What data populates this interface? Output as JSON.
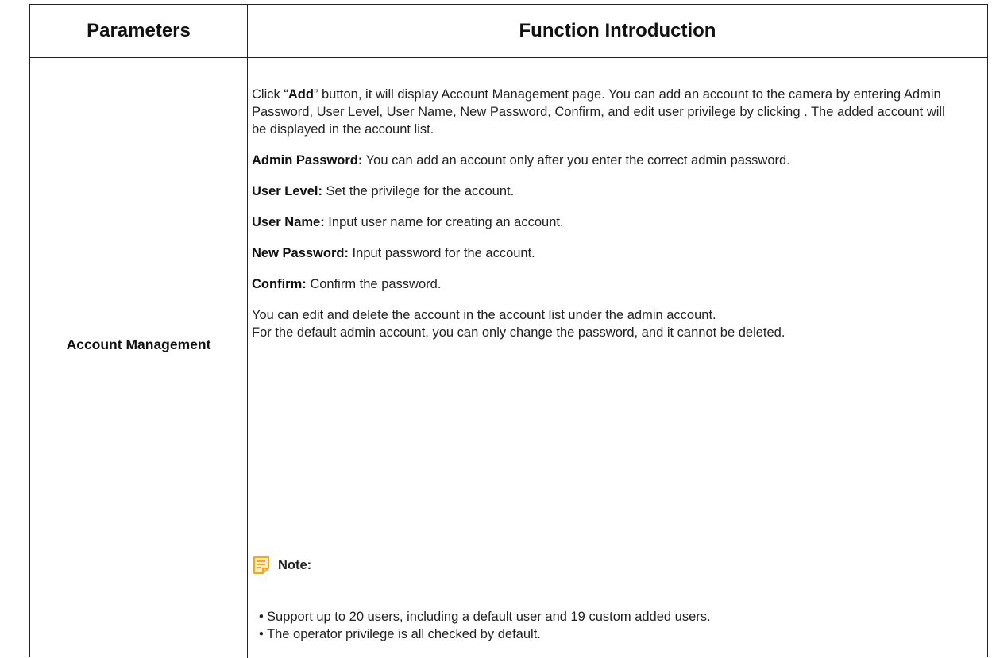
{
  "header": {
    "parameters": "Parameters",
    "function_introduction": "Function Introduction"
  },
  "row": {
    "parameter": "Account Management",
    "intro": {
      "p1_a": "Click “",
      "p1_add": "Add",
      "p1_b": "” button, it will display Account Management page. You can add an account to the camera by entering Admin Password, User Level, User Name, New Password, Confirm, and edit user privilege by clicking . The added account will be displayed in the account list.",
      "items": [
        {
          "term": "Admin Password:",
          "desc": " You can add an account only after you enter the correct admin password."
        },
        {
          "term": "User Level:",
          "desc": " Set the privilege for the account."
        },
        {
          "term": "User Name:",
          "desc": " Input user name for creating an account."
        },
        {
          "term": "New Password:",
          "desc": " Input password for the account."
        },
        {
          "term": "Confirm:",
          "desc": " Confirm the password."
        }
      ],
      "p_edit_1": "You can edit and delete the account in the account list under the admin account.",
      "p_edit_2": "For the default admin account, you can only change the password, and it cannot be deleted."
    },
    "note": {
      "icon": "note-icon",
      "label": "Note:",
      "bullet": "•",
      "items": [
        "Support up to 20 users, including a default user and 19 custom added users.",
        "The operator privilege is all checked by default."
      ]
    }
  },
  "colors": {
    "note_icon": "#f5a623",
    "border": "#222222",
    "text": "#222222"
  }
}
